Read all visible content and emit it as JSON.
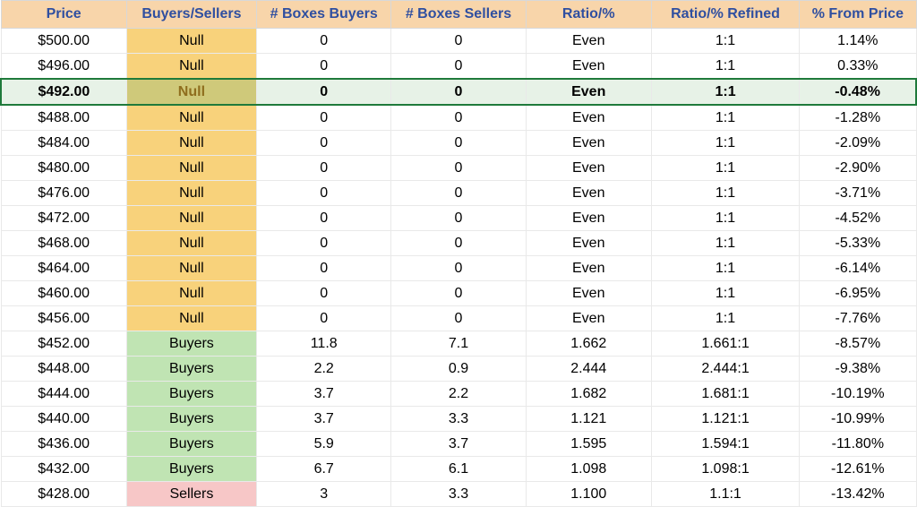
{
  "columns": [
    "Price",
    "Buyers/Sellers",
    "# Boxes Buyers",
    "# Boxes Sellers",
    "Ratio/%",
    "Ratio/% Refined",
    "% From Price"
  ],
  "highlight_index": 2,
  "rows": [
    {
      "price": "$500.00",
      "bs": "Null",
      "nbb": "0",
      "nbs": "0",
      "ratio": "Even",
      "refined": "1:1",
      "pct": "1.14%"
    },
    {
      "price": "$496.00",
      "bs": "Null",
      "nbb": "0",
      "nbs": "0",
      "ratio": "Even",
      "refined": "1:1",
      "pct": "0.33%"
    },
    {
      "price": "$492.00",
      "bs": "Null",
      "nbb": "0",
      "nbs": "0",
      "ratio": "Even",
      "refined": "1:1",
      "pct": "-0.48%"
    },
    {
      "price": "$488.00",
      "bs": "Null",
      "nbb": "0",
      "nbs": "0",
      "ratio": "Even",
      "refined": "1:1",
      "pct": "-1.28%"
    },
    {
      "price": "$484.00",
      "bs": "Null",
      "nbb": "0",
      "nbs": "0",
      "ratio": "Even",
      "refined": "1:1",
      "pct": "-2.09%"
    },
    {
      "price": "$480.00",
      "bs": "Null",
      "nbb": "0",
      "nbs": "0",
      "ratio": "Even",
      "refined": "1:1",
      "pct": "-2.90%"
    },
    {
      "price": "$476.00",
      "bs": "Null",
      "nbb": "0",
      "nbs": "0",
      "ratio": "Even",
      "refined": "1:1",
      "pct": "-3.71%"
    },
    {
      "price": "$472.00",
      "bs": "Null",
      "nbb": "0",
      "nbs": "0",
      "ratio": "Even",
      "refined": "1:1",
      "pct": "-4.52%"
    },
    {
      "price": "$468.00",
      "bs": "Null",
      "nbb": "0",
      "nbs": "0",
      "ratio": "Even",
      "refined": "1:1",
      "pct": "-5.33%"
    },
    {
      "price": "$464.00",
      "bs": "Null",
      "nbb": "0",
      "nbs": "0",
      "ratio": "Even",
      "refined": "1:1",
      "pct": "-6.14%"
    },
    {
      "price": "$460.00",
      "bs": "Null",
      "nbb": "0",
      "nbs": "0",
      "ratio": "Even",
      "refined": "1:1",
      "pct": "-6.95%"
    },
    {
      "price": "$456.00",
      "bs": "Null",
      "nbb": "0",
      "nbs": "0",
      "ratio": "Even",
      "refined": "1:1",
      "pct": "-7.76%"
    },
    {
      "price": "$452.00",
      "bs": "Buyers",
      "nbb": "11.8",
      "nbs": "7.1",
      "ratio": "1.662",
      "refined": "1.661:1",
      "pct": "-8.57%"
    },
    {
      "price": "$448.00",
      "bs": "Buyers",
      "nbb": "2.2",
      "nbs": "0.9",
      "ratio": "2.444",
      "refined": "2.444:1",
      "pct": "-9.38%"
    },
    {
      "price": "$444.00",
      "bs": "Buyers",
      "nbb": "3.7",
      "nbs": "2.2",
      "ratio": "1.682",
      "refined": "1.681:1",
      "pct": "-10.19%"
    },
    {
      "price": "$440.00",
      "bs": "Buyers",
      "nbb": "3.7",
      "nbs": "3.3",
      "ratio": "1.121",
      "refined": "1.121:1",
      "pct": "-10.99%"
    },
    {
      "price": "$436.00",
      "bs": "Buyers",
      "nbb": "5.9",
      "nbs": "3.7",
      "ratio": "1.595",
      "refined": "1.594:1",
      "pct": "-11.80%"
    },
    {
      "price": "$432.00",
      "bs": "Buyers",
      "nbb": "6.7",
      "nbs": "6.1",
      "ratio": "1.098",
      "refined": "1.098:1",
      "pct": "-12.61%"
    },
    {
      "price": "$428.00",
      "bs": "Sellers",
      "nbb": "3",
      "nbs": "3.3",
      "ratio": "1.100",
      "refined": "1.1:1",
      "pct": "-13.42%"
    }
  ]
}
